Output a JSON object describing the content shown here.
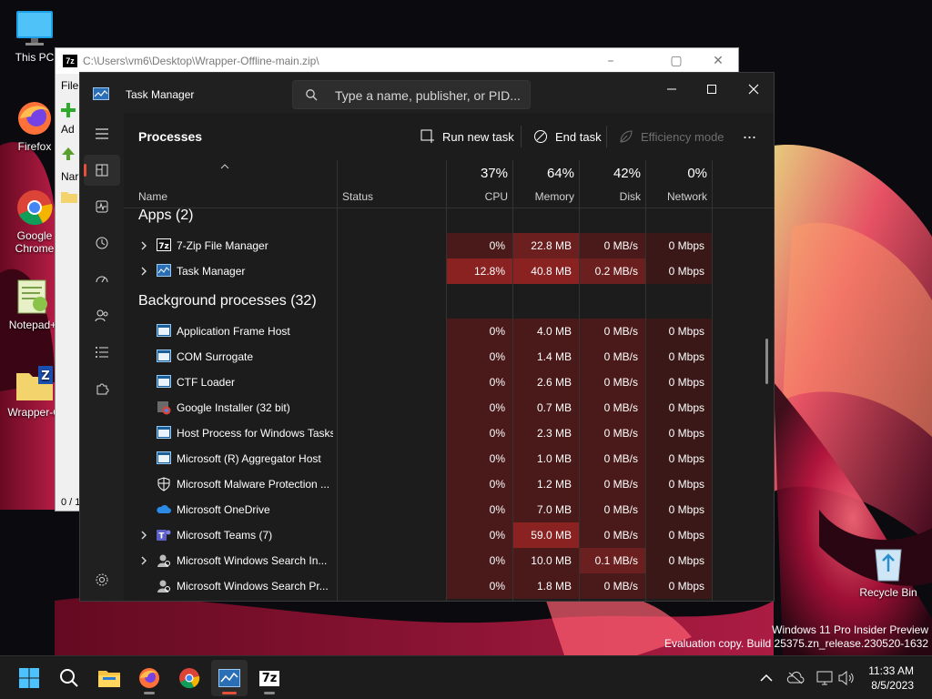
{
  "desktop": {
    "icons": [
      {
        "label": "This PC"
      },
      {
        "label": "Firefox"
      },
      {
        "label": "Google Chrome"
      },
      {
        "label": "Notepad+"
      },
      {
        "label": "Wrapper-O"
      }
    ],
    "recycle_bin": "Recycle Bin",
    "watermark_line1": "Windows 11 Pro Insider Preview",
    "watermark_line2": "Evaluation copy. Build 25375.zn_release.230520-1632"
  },
  "zip_window": {
    "title": "C:\\Users\\vm6\\Desktop\\Wrapper-Offline-main.zip\\",
    "icon_label": "7z",
    "side_file": "File",
    "side_add": "Ad",
    "side_name": "Nar",
    "side_status": "0 / 1"
  },
  "task_manager": {
    "title": "Task Manager",
    "search_placeholder": "Type a name, publisher, or PID...",
    "page_title": "Processes",
    "toolbar": {
      "run_new_task": "Run new task",
      "end_task": "End task",
      "efficiency_mode": "Efficiency mode",
      "more": "..."
    },
    "columns": {
      "name": "Name",
      "status": "Status",
      "cpu_pct": "37%",
      "cpu": "CPU",
      "memory_pct": "64%",
      "memory": "Memory",
      "disk_pct": "42%",
      "disk": "Disk",
      "network_pct": "0%",
      "network": "Network"
    },
    "apps_header": "Apps (2)",
    "apps": [
      {
        "name": "7-Zip File Manager",
        "cpu": "0%",
        "memory": "22.8 MB",
        "disk": "0 MB/s",
        "network": "0 Mbps",
        "expandable": true,
        "icon": "7zip-icon"
      },
      {
        "name": "Task Manager",
        "cpu": "12.8%",
        "memory": "40.8 MB",
        "disk": "0.2 MB/s",
        "network": "0 Mbps",
        "expandable": true,
        "icon": "task-manager-icon"
      }
    ],
    "bg_header": "Background processes (32)",
    "background": [
      {
        "name": "Application Frame Host",
        "cpu": "0%",
        "memory": "4.0 MB",
        "disk": "0 MB/s",
        "network": "0 Mbps",
        "expandable": false,
        "icon": "window-icon"
      },
      {
        "name": "COM Surrogate",
        "cpu": "0%",
        "memory": "1.4 MB",
        "disk": "0 MB/s",
        "network": "0 Mbps",
        "expandable": false,
        "icon": "window-icon"
      },
      {
        "name": "CTF Loader",
        "cpu": "0%",
        "memory": "2.6 MB",
        "disk": "0 MB/s",
        "network": "0 Mbps",
        "expandable": false,
        "icon": "window-icon"
      },
      {
        "name": "Google Installer (32 bit)",
        "cpu": "0%",
        "memory": "0.7 MB",
        "disk": "0 MB/s",
        "network": "0 Mbps",
        "expandable": false,
        "icon": "installer-icon"
      },
      {
        "name": "Host Process for Windows Tasks",
        "cpu": "0%",
        "memory": "2.3 MB",
        "disk": "0 MB/s",
        "network": "0 Mbps",
        "expandable": false,
        "icon": "window-icon"
      },
      {
        "name": "Microsoft (R) Aggregator Host",
        "cpu": "0%",
        "memory": "1.0 MB",
        "disk": "0 MB/s",
        "network": "0 Mbps",
        "expandable": false,
        "icon": "window-icon"
      },
      {
        "name": "Microsoft Malware Protection ...",
        "cpu": "0%",
        "memory": "1.2 MB",
        "disk": "0 MB/s",
        "network": "0 Mbps",
        "expandable": false,
        "icon": "shield-icon"
      },
      {
        "name": "Microsoft OneDrive",
        "cpu": "0%",
        "memory": "7.0 MB",
        "disk": "0 MB/s",
        "network": "0 Mbps",
        "expandable": false,
        "icon": "cloud-icon"
      },
      {
        "name": "Microsoft Teams (7)",
        "cpu": "0%",
        "memory": "59.0 MB",
        "disk": "0 MB/s",
        "network": "0 Mbps",
        "expandable": true,
        "icon": "teams-icon"
      },
      {
        "name": "Microsoft Windows Search In...",
        "cpu": "0%",
        "memory": "10.0 MB",
        "disk": "0.1 MB/s",
        "network": "0 Mbps",
        "expandable": true,
        "icon": "search-user-icon"
      },
      {
        "name": "Microsoft Windows Search Pr...",
        "cpu": "0%",
        "memory": "1.8 MB",
        "disk": "0 MB/s",
        "network": "0 Mbps",
        "expandable": false,
        "icon": "search-user-icon"
      }
    ]
  },
  "taskbar": {
    "time": "11:33 AM",
    "date": "8/5/2023",
    "zip_label": "7z"
  },
  "colors": {
    "accent": "#e84f3b",
    "heat_low": "#4a1a1a",
    "heat_mid": "#6b1f1f",
    "heat_high": "#8a2222"
  }
}
